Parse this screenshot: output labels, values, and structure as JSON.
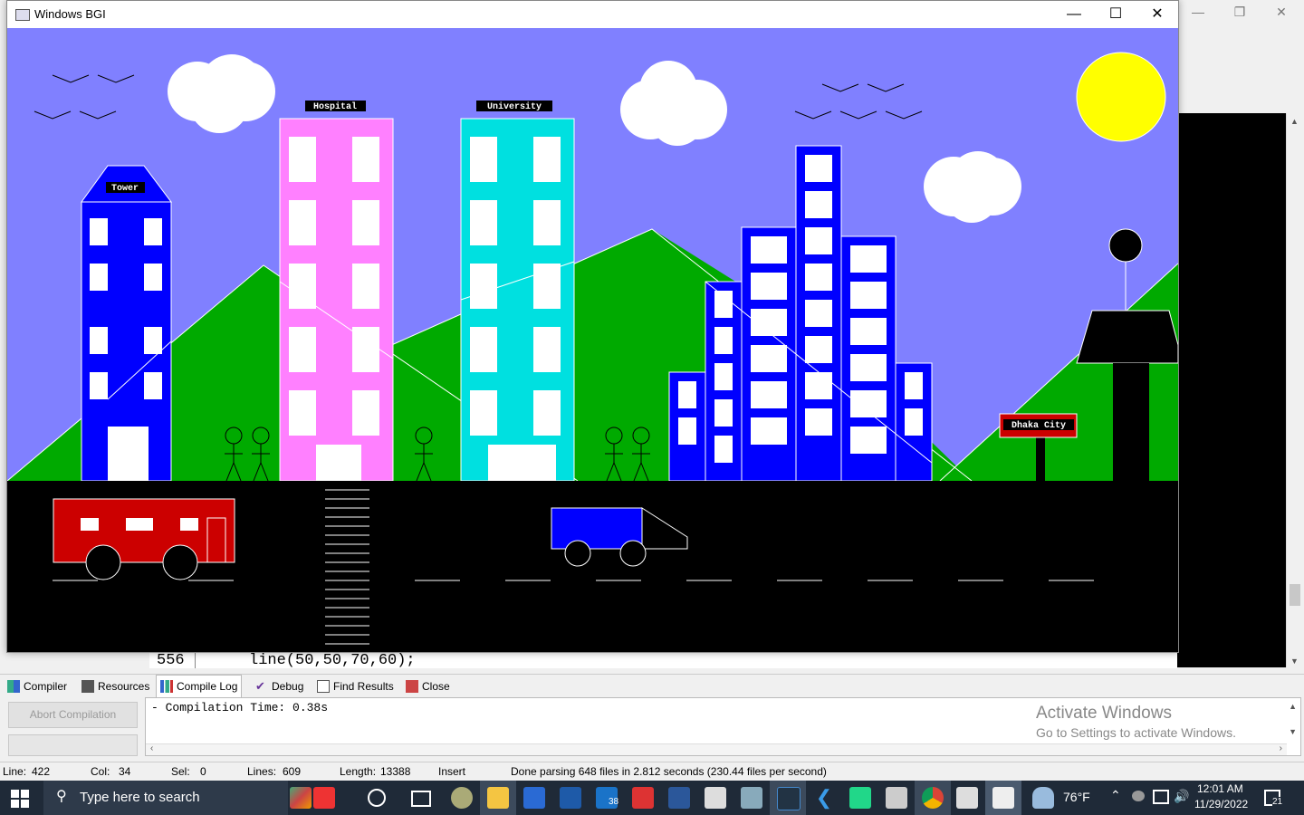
{
  "bgi_window": {
    "title": "Windows BGI",
    "labels": {
      "tower": "Tower",
      "hospital": "Hospital",
      "university": "University",
      "sign": "Dhaka City"
    }
  },
  "editor": {
    "line_number": "556",
    "code": "line(50,50,70,60);"
  },
  "bottom_tabs": [
    "Compiler",
    "Resources",
    "Compile Log",
    "Debug",
    "Find Results",
    "Close"
  ],
  "compile_log": {
    "abort_label": "Abort Compilation",
    "log_text": "- Compilation Time: 0.38s"
  },
  "watermark": {
    "title": "Activate Windows",
    "subtitle": "Go to Settings to activate Windows."
  },
  "status_bar": {
    "line_label": "Line:",
    "line_value": "422",
    "col_label": "Col:",
    "col_value": "34",
    "sel_label": "Sel:",
    "sel_value": "0",
    "lines_label": "Lines:",
    "lines_value": "609",
    "length_label": "Length:",
    "length_value": "13388",
    "mode": "Insert",
    "message": "Done parsing 648 files in 2.812 seconds (230.44 files per second)"
  },
  "taskbar": {
    "search_placeholder": "Type here to search",
    "mail_badge": "38",
    "weather": "76°F",
    "time": "12:01 AM",
    "date": "11/29/2022",
    "notifications": "21"
  },
  "colors": {
    "sky": "#8080ff",
    "hill": "#00aa00",
    "road": "#000000",
    "tower": "#0000ff",
    "hospital": "#ff80ff",
    "university": "#00e0e0",
    "bus": "#cc0000",
    "truck": "#0000ff",
    "sun": "#ffff00"
  }
}
